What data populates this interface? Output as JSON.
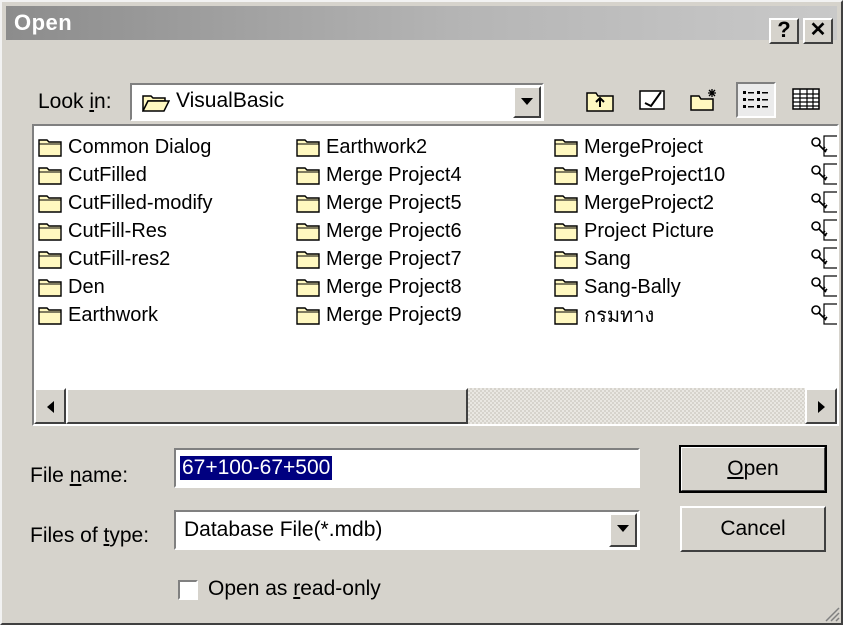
{
  "window": {
    "title": "Open",
    "help_button": "?",
    "close_button": "✕"
  },
  "lookin": {
    "label_pre": "Look ",
    "label_u": "i",
    "label_post": "n:",
    "value": "VisualBasic"
  },
  "toolbar": {
    "icons": [
      "up-one-level-icon",
      "desktop-icon",
      "new-folder-icon",
      "list-view-icon",
      "details-view-icon"
    ]
  },
  "files": {
    "columns": [
      [
        "Common Dialog",
        "CutFilled",
        "CutFilled-modify",
        "CutFill-Res",
        "CutFill-res2",
        "Den",
        "Earthwork"
      ],
      [
        "Earthwork2",
        "Merge Project4",
        "Merge Project5",
        "Merge Project6",
        "Merge Project7",
        "Merge Project8",
        "Merge Project9"
      ],
      [
        "MergeProject",
        "MergeProject10",
        "MergeProject2",
        "Project Picture",
        "Sang",
        "Sang-Bally",
        "กรมทาง"
      ]
    ],
    "partial_column_icon": "database-key-icon"
  },
  "filename": {
    "label_pre": "File ",
    "label_u": "n",
    "label_post": "ame:",
    "value": "67+100-67+500"
  },
  "filetype": {
    "label_pre": "Files of ",
    "label_u": "t",
    "label_post": "ype:",
    "value": "Database File(*.mdb)"
  },
  "readonly": {
    "label_pre": "Open as ",
    "label_u": "r",
    "label_post": "ead-only",
    "checked": false
  },
  "buttons": {
    "open_u": "O",
    "open_post": "pen",
    "cancel": "Cancel"
  },
  "colors": {
    "face": "#d6d3cc",
    "titlebar": "#8c8c8c",
    "selection": "#000080",
    "folder": "#fff8c0"
  }
}
